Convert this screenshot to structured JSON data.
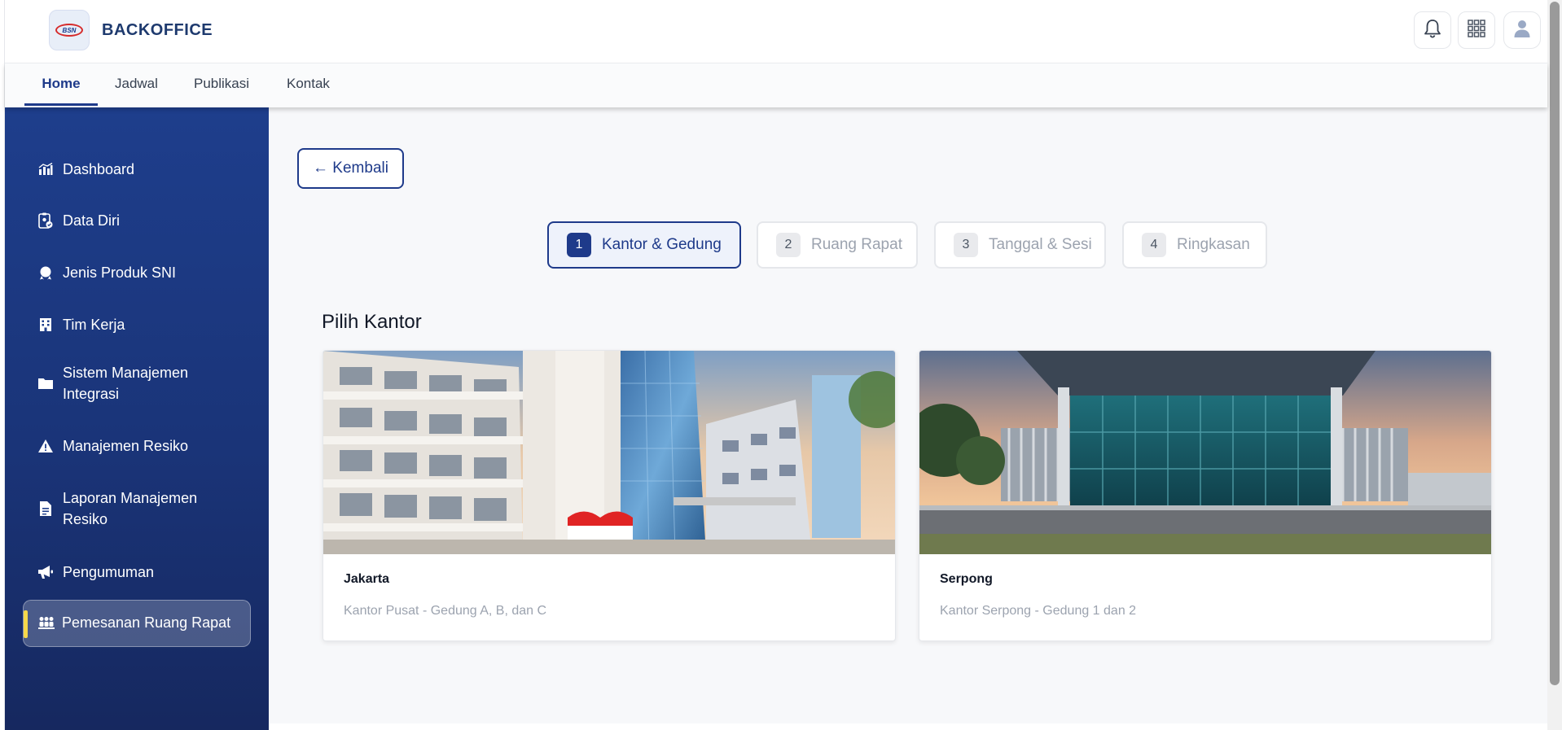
{
  "header": {
    "brand": "BACKOFFICE",
    "logo_text": "BSN"
  },
  "nav": {
    "items": [
      {
        "label": "Home",
        "active": true
      },
      {
        "label": "Jadwal",
        "active": false
      },
      {
        "label": "Publikasi",
        "active": false
      },
      {
        "label": "Kontak",
        "active": false
      }
    ]
  },
  "sidebar": {
    "items": [
      {
        "label": "Dashboard",
        "icon": "chart-icon"
      },
      {
        "label": "Data Diri",
        "icon": "clipboard-user-icon"
      },
      {
        "label": "Jenis Produk SNI",
        "icon": "seal-icon"
      },
      {
        "label": "Tim Kerja",
        "icon": "building-icon"
      },
      {
        "label": "Sistem Manajemen Integrasi",
        "icon": "folder-icon"
      },
      {
        "label": "Manajemen Resiko",
        "icon": "warning-icon"
      },
      {
        "label": "Laporan Manajemen Resiko",
        "icon": "document-icon"
      },
      {
        "label": "Pengumuman",
        "icon": "megaphone-icon"
      },
      {
        "label": "Pemesanan Ruang Rapat",
        "icon": "people-icon",
        "active": true
      }
    ]
  },
  "main": {
    "back_label": "← Kembali",
    "steps": [
      {
        "num": "1",
        "label": "Kantor & Gedung",
        "active": true
      },
      {
        "num": "2",
        "label": "Ruang Rapat",
        "active": false
      },
      {
        "num": "3",
        "label": "Tanggal & Sesi",
        "active": false
      },
      {
        "num": "4",
        "label": "Ringkasan",
        "active": false
      }
    ],
    "section_title": "Pilih Kantor",
    "offices": [
      {
        "name": "Jakarta",
        "description": "Kantor Pusat - Gedung A, B, dan C"
      },
      {
        "name": "Serpong",
        "description": "Kantor Serpong - Gedung 1 dan 2"
      }
    ]
  },
  "colors": {
    "primary": "#1e3a8a",
    "sidebar_top": "#1e3e8c",
    "sidebar_bottom": "#16285f",
    "active_indicator": "#f6d84a"
  }
}
